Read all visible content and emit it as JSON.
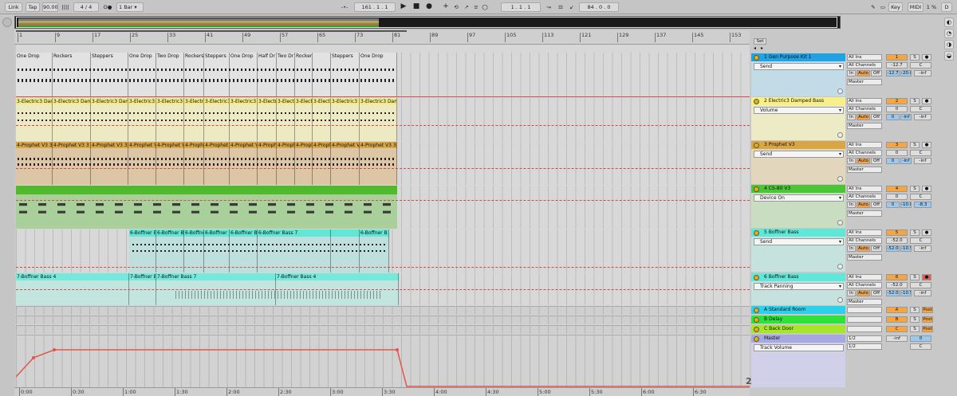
{
  "transport": {
    "link": "Link",
    "tap": "Tap",
    "tempo": "90.00",
    "sig": "4 / 4",
    "quant": "1 Bar",
    "position": "161 . 1 . 1",
    "loop_start": "1 . 1 . 1",
    "loop_len": "84 . 0 . 0",
    "key": "Key",
    "midi": "MIDI",
    "cpu": "1 %",
    "disk": "D"
  },
  "ruler_ticks": [
    "1",
    "9",
    "17",
    "25",
    "33",
    "41",
    "49",
    "57",
    "65",
    "73",
    "81",
    "89",
    "97",
    "105",
    "113",
    "121",
    "129",
    "137",
    "145",
    "153"
  ],
  "time_ticks": [
    "0:00",
    "0:30",
    "1:00",
    "1:30",
    "2:00",
    "2:30",
    "3:00",
    "3:30",
    "4:00",
    "4:30",
    "5:00",
    "5:30",
    "6:00",
    "6:30"
  ],
  "set_label": "Set",
  "lane1_clips": [
    "One Drop",
    "Rockers",
    "Steppers",
    "One Drop",
    "Two Drop",
    "Rockers",
    "Steppers",
    "One Drop",
    "Half Dr",
    "Two Dr",
    "Rockers",
    "",
    "Steppers",
    "One Drop"
  ],
  "lane2_label": "3-Electric3 Dam",
  "lane3_label": "4-Prophet V3 3",
  "lane5_label": "6-Boffner B",
  "lane5_clips": [
    "6-Boffner B",
    "6-Boffner B",
    "6-Boffner B",
    "6-Boffner B",
    "6-Boffner B",
    "6-Boffner Bass 7",
    "",
    "6-Boffner B"
  ],
  "lane6_clips": [
    "7-Boffner Bass 4",
    "7-Boffner Bass 7",
    "7-Boffner Bass 7",
    "7-Boffner Bass 4"
  ],
  "tracks": [
    {
      "name": "1 Gen Purpose Kit 1",
      "param": "Send",
      "input": "All Ins",
      "channel": "All Channels",
      "num": "1",
      "vol": "-12.7",
      "pan": "-20.0",
      "peak": "-inf",
      "color": "#1fa3e6",
      "bg": "#c2dbe6"
    },
    {
      "name": "2 Electric3 Damped Bass",
      "param": "Volume",
      "input": "All Ins",
      "channel": "All Channels",
      "num": "2",
      "vol": "0",
      "pan": "-inf",
      "peak": "-inf",
      "color": "#f6ef8a",
      "bg": "#ecebc6"
    },
    {
      "name": "3 Prophet V3",
      "param": "Send",
      "input": "All Ins",
      "channel": "All Channels",
      "num": "3",
      "vol": "0",
      "pan": "-inf",
      "peak": "-inf",
      "color": "#d9a545",
      "bg": "#e2d6bd"
    },
    {
      "name": "4 CS-80 V3",
      "param": "Device On",
      "input": "All Ins",
      "channel": "All Channels",
      "num": "4",
      "vol": "0",
      "pan": "-10.8",
      "peak": "-8.3",
      "color": "#4bc436",
      "bg": "#c9ddc1"
    },
    {
      "name": "5 Boffner Bass",
      "param": "Send",
      "input": "All Ins",
      "channel": "All Channels",
      "num": "5",
      "vol": "-52.0",
      "pan": "-10.5",
      "peak": "-inf",
      "color": "#5fe7d9",
      "bg": "#c6e2df"
    },
    {
      "name": "6 Boffner Bass",
      "param": "Track Panning",
      "input": "All Ins",
      "channel": "All Channels",
      "num": "6",
      "vol": "-52.0",
      "pan": "-10.5",
      "peak": "-inf",
      "color": "#5fe7d9",
      "bg": "#c6e2df"
    }
  ],
  "returns": [
    {
      "name": "A Standard Room",
      "letter": "A",
      "post": "Post",
      "color": "#2bd0ea"
    },
    {
      "name": "B Delay",
      "letter": "B",
      "post": "Post",
      "color": "#2fe23a"
    },
    {
      "name": "C Back Door",
      "letter": "C",
      "post": "Post",
      "color": "#a4e62a"
    }
  ],
  "master": {
    "name": "Master",
    "param": "Track Volume",
    "cue": "1/2",
    "out": "1/2",
    "vol": "-inf",
    "pan": "0",
    "color": "#a6a8e0"
  },
  "common": {
    "in": "In",
    "auto": "Auto",
    "off": "Off",
    "master_out": "Master",
    "s": "S",
    "zero": "0",
    "c": "C"
  },
  "pct": "2/1"
}
